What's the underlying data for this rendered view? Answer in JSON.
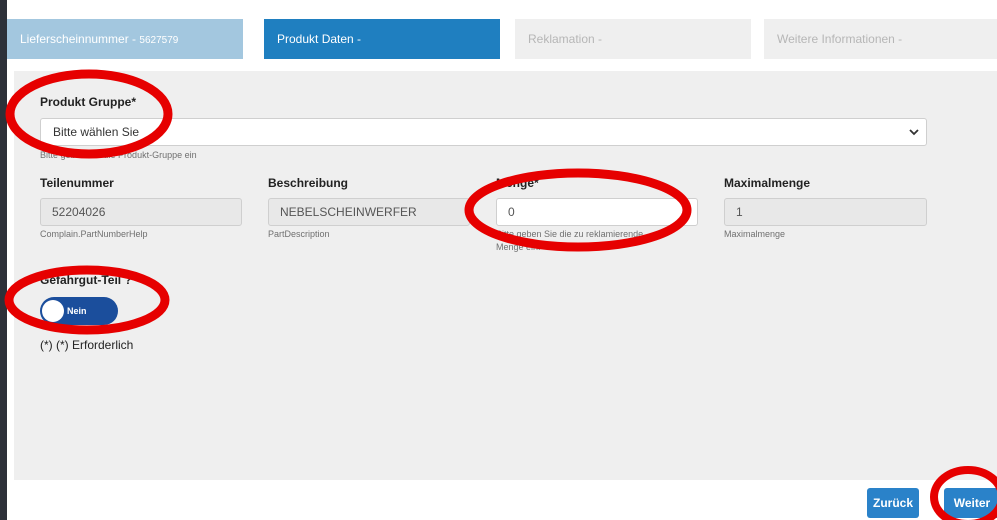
{
  "steps": [
    {
      "label": "Lieferscheinnummer - ",
      "number": "5627579"
    },
    {
      "label": "Produkt Daten -"
    },
    {
      "label": "Reklamation -"
    },
    {
      "label": "Weitere Informationen -"
    }
  ],
  "form": {
    "produkt_gruppe": {
      "label": "Produkt Gruppe*",
      "value": "Bitte wählen Sie",
      "help": "Bitte geben Sie die Produkt-Gruppe ein"
    },
    "teilenummer": {
      "label": "Teilenummer",
      "value": "52204026",
      "help": "Complain.PartNumberHelp"
    },
    "beschreibung": {
      "label": "Beschreibung",
      "value": "NEBELSCHEINWERFER",
      "help": "PartDescription"
    },
    "menge": {
      "label": "Menge*",
      "value": "0",
      "help_line1": "Bitte geben Sie die zu reklamierende",
      "help_line2": "Menge ein."
    },
    "maximalmenge": {
      "label": "Maximalmenge",
      "value": "1",
      "help": "Maximalmenge"
    },
    "gefahrgut": {
      "label": "Gefahrgut-Teil ?",
      "toggle_text": "Nein"
    },
    "required_note": "(*) (*) Erforderlich"
  },
  "buttons": {
    "back": "Zurück",
    "next": "Weiter"
  },
  "colors": {
    "accent": "#1f7fc0",
    "step_done": "#a3c7df",
    "toggle": "#1b4e9c",
    "annotation": "#e60000"
  }
}
